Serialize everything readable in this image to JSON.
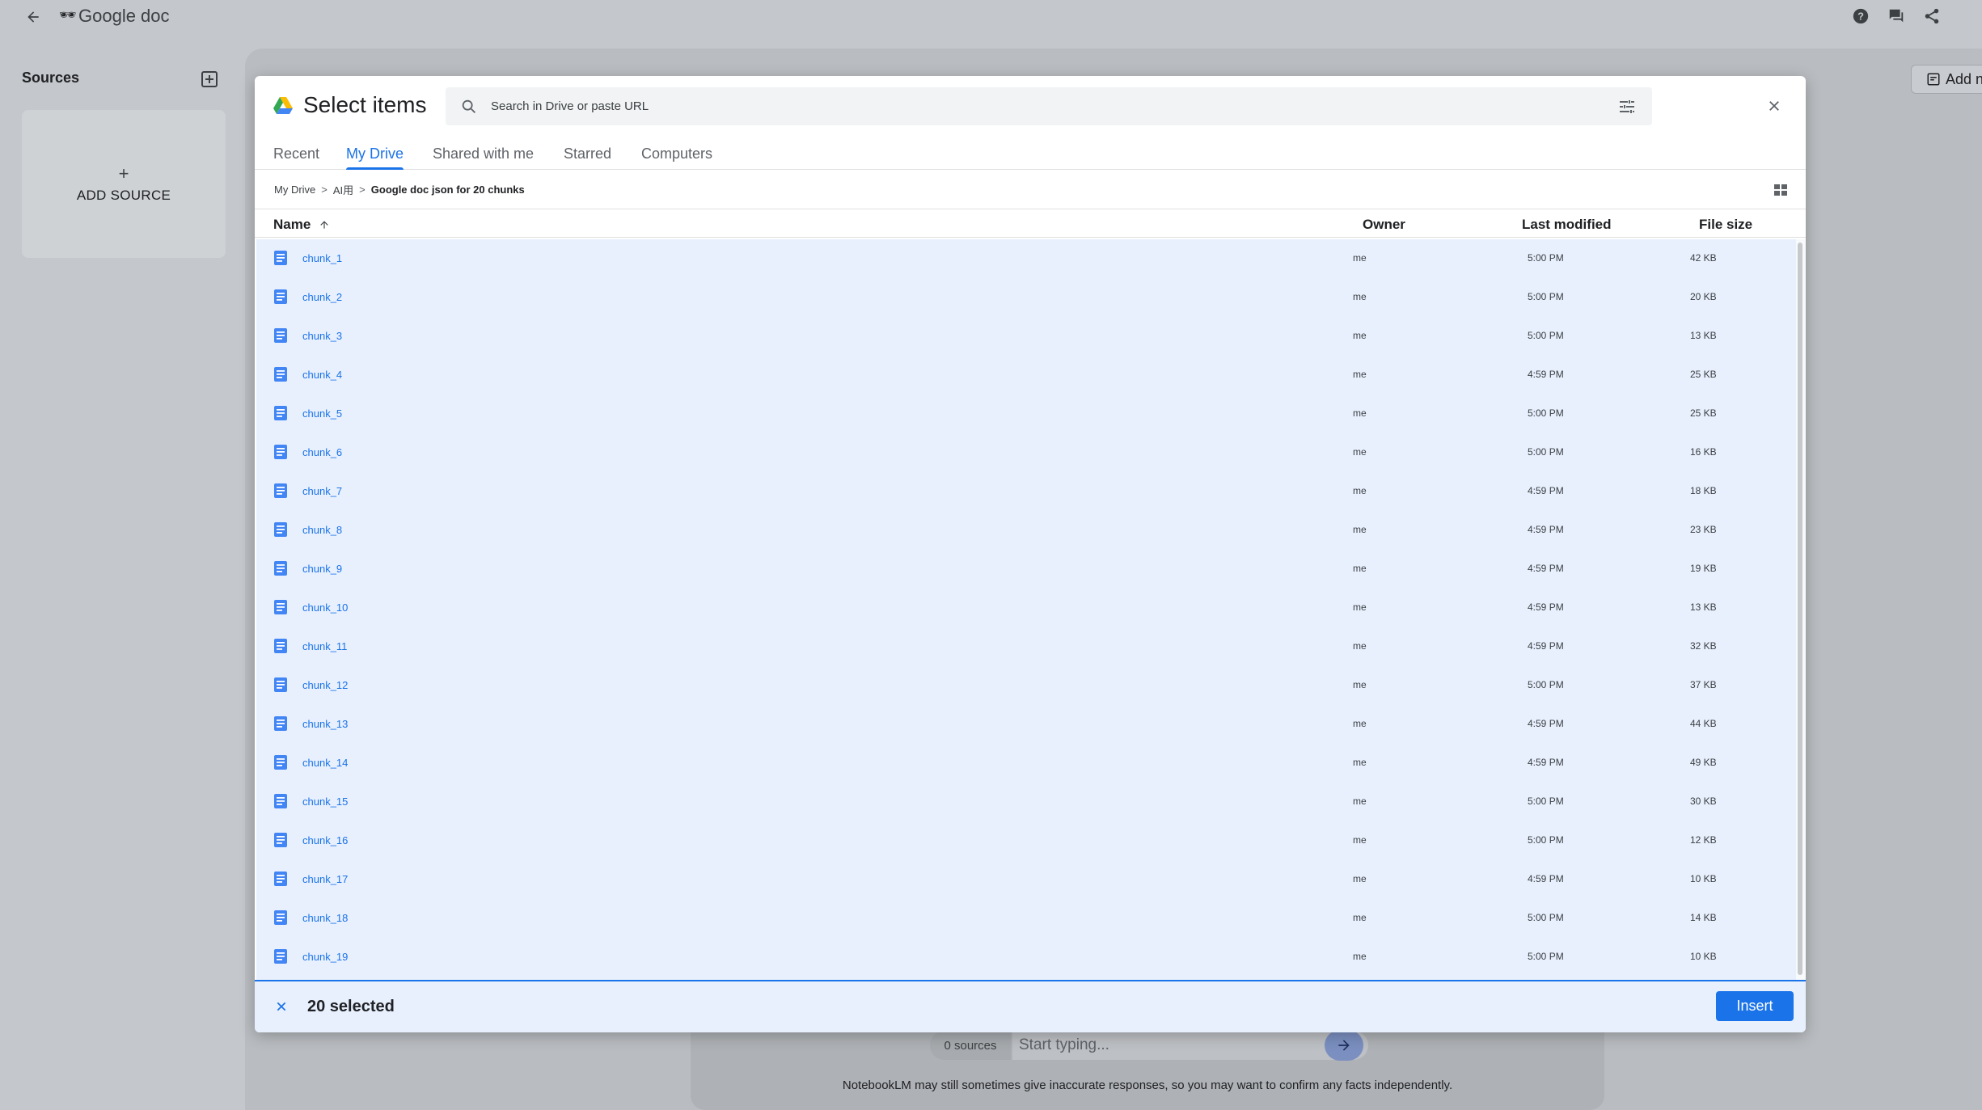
{
  "app": {
    "title": "Google doc",
    "title_emoji": "🕶"
  },
  "sidebar": {
    "sources_label": "Sources",
    "add_source_label": "ADD SOURCE",
    "add_source_plus": "+"
  },
  "main": {
    "add_note_label": "Add n"
  },
  "chat": {
    "sources_count": "0 sources",
    "placeholder": "Start typing...",
    "disclaimer": "NotebookLM may still sometimes give inaccurate responses, so you may want to confirm any facts independently."
  },
  "dialog": {
    "title": "Select items",
    "search_placeholder": "Search in Drive or paste URL",
    "tabs": [
      {
        "label": "Recent",
        "active": false
      },
      {
        "label": "My Drive",
        "active": true
      },
      {
        "label": "Shared with me",
        "active": false
      },
      {
        "label": "Starred",
        "active": false
      },
      {
        "label": "Computers",
        "active": false
      }
    ],
    "breadcrumb": [
      "My Drive",
      "AI用",
      "Google doc json for 20 chunks"
    ],
    "columns": {
      "name": "Name",
      "owner": "Owner",
      "last_modified": "Last modified",
      "file_size": "File size"
    },
    "files": [
      {
        "name": "chunk_1",
        "owner": "me",
        "modified": "5:00 PM",
        "size": "42 KB"
      },
      {
        "name": "chunk_2",
        "owner": "me",
        "modified": "5:00 PM",
        "size": "20 KB"
      },
      {
        "name": "chunk_3",
        "owner": "me",
        "modified": "5:00 PM",
        "size": "13 KB"
      },
      {
        "name": "chunk_4",
        "owner": "me",
        "modified": "4:59 PM",
        "size": "25 KB"
      },
      {
        "name": "chunk_5",
        "owner": "me",
        "modified": "5:00 PM",
        "size": "25 KB"
      },
      {
        "name": "chunk_6",
        "owner": "me",
        "modified": "5:00 PM",
        "size": "16 KB"
      },
      {
        "name": "chunk_7",
        "owner": "me",
        "modified": "4:59 PM",
        "size": "18 KB"
      },
      {
        "name": "chunk_8",
        "owner": "me",
        "modified": "4:59 PM",
        "size": "23 KB"
      },
      {
        "name": "chunk_9",
        "owner": "me",
        "modified": "4:59 PM",
        "size": "19 KB"
      },
      {
        "name": "chunk_10",
        "owner": "me",
        "modified": "4:59 PM",
        "size": "13 KB"
      },
      {
        "name": "chunk_11",
        "owner": "me",
        "modified": "4:59 PM",
        "size": "32 KB"
      },
      {
        "name": "chunk_12",
        "owner": "me",
        "modified": "5:00 PM",
        "size": "37 KB"
      },
      {
        "name": "chunk_13",
        "owner": "me",
        "modified": "4:59 PM",
        "size": "44 KB"
      },
      {
        "name": "chunk_14",
        "owner": "me",
        "modified": "4:59 PM",
        "size": "49 KB"
      },
      {
        "name": "chunk_15",
        "owner": "me",
        "modified": "5:00 PM",
        "size": "30 KB"
      },
      {
        "name": "chunk_16",
        "owner": "me",
        "modified": "5:00 PM",
        "size": "12 KB"
      },
      {
        "name": "chunk_17",
        "owner": "me",
        "modified": "4:59 PM",
        "size": "10 KB"
      },
      {
        "name": "chunk_18",
        "owner": "me",
        "modified": "5:00 PM",
        "size": "14 KB"
      },
      {
        "name": "chunk_19",
        "owner": "me",
        "modified": "5:00 PM",
        "size": "10 KB"
      }
    ],
    "selected_count": "20 selected",
    "insert_label": "Insert"
  },
  "icons": {
    "back": "arrow-back-icon",
    "help": "help-icon",
    "chat": "chat-icon",
    "share": "share-icon",
    "drive": "google-drive-icon",
    "search": "search-icon",
    "tune": "tune-icon",
    "close": "close-icon",
    "grid": "grid-view-icon",
    "doc": "google-doc-icon",
    "sort": "arrow-up-icon"
  },
  "colors": {
    "accent": "#1a73e8",
    "selection_bg": "#e8f0fe",
    "overlay_bg": "#c4c7cb"
  }
}
